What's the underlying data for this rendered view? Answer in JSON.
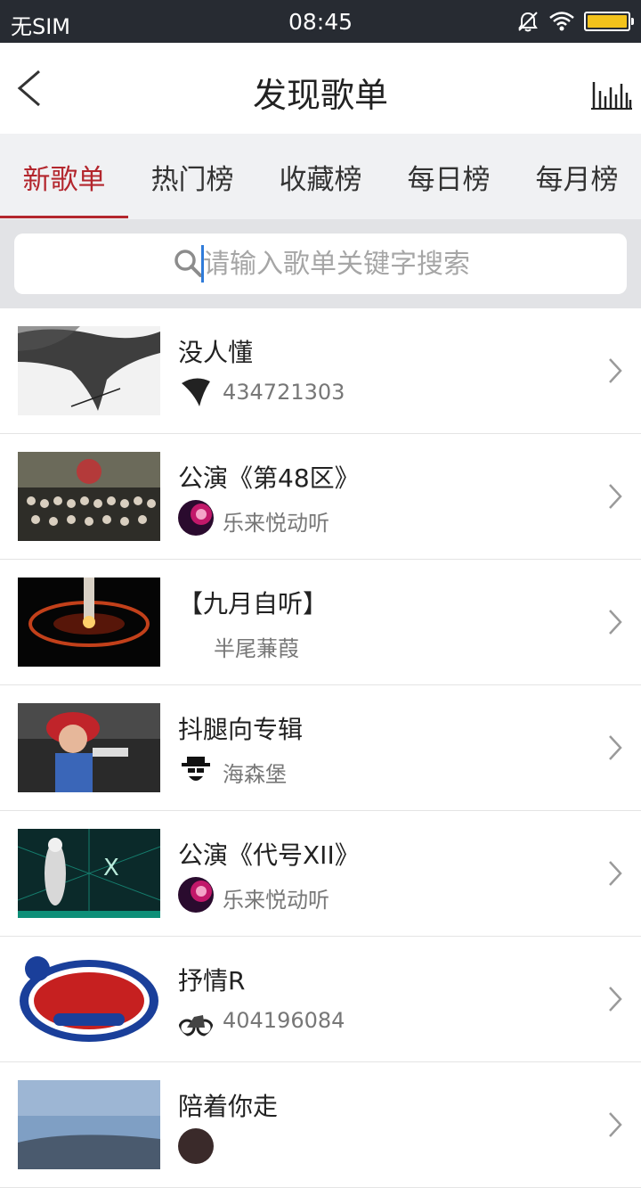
{
  "status_bar": {
    "carrier": "无SIM",
    "time": "08:45",
    "battery_level": 0.95
  },
  "nav": {
    "title": "发现歌单",
    "back_icon": "chevron-left-icon",
    "right_icon": "equalizer-icon"
  },
  "tabs": [
    {
      "label": "新歌单",
      "active": true
    },
    {
      "label": "热门榜",
      "active": false
    },
    {
      "label": "收藏榜",
      "active": false
    },
    {
      "label": "每日榜",
      "active": false
    },
    {
      "label": "每月榜",
      "active": false
    }
  ],
  "search": {
    "placeholder": "请输入歌单关键字搜索",
    "value": ""
  },
  "playlists": [
    {
      "title": "没人懂",
      "author": "434721303"
    },
    {
      "title": "公演《第48区》",
      "author": "乐来悦动听"
    },
    {
      "title": "【九月自听】",
      "author": "半尾蒹葭"
    },
    {
      "title": "抖腿向专辑",
      "author": "海森堡"
    },
    {
      "title": "公演《代号XII》",
      "author": "乐来悦动听"
    },
    {
      "title": "抒情R",
      "author": "404196084"
    },
    {
      "title": "陪着你走",
      "author": ""
    }
  ],
  "colors": {
    "accent": "#b3262d",
    "status_bar": "#272b32",
    "tab_bg": "#f0f1f3",
    "search_bg": "#e2e3e6"
  }
}
